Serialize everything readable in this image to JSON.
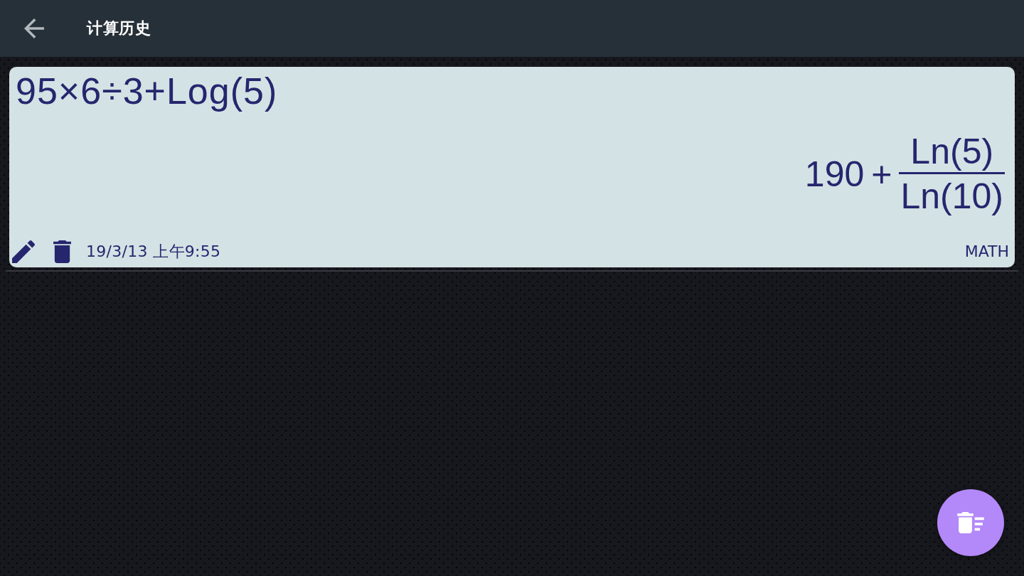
{
  "app_bar": {
    "title": "计算历史"
  },
  "history": [
    {
      "expression": "95×6÷3+Log(5)",
      "result": [
        {
          "kind": "text",
          "text": "190"
        },
        {
          "kind": "text",
          "text": "+"
        },
        {
          "kind": "fraction",
          "numerator": "Ln(5)",
          "denominator": "Ln(10)"
        }
      ],
      "timestamp": "19/3/13 上午9:55",
      "mode": "MATH"
    }
  ]
}
